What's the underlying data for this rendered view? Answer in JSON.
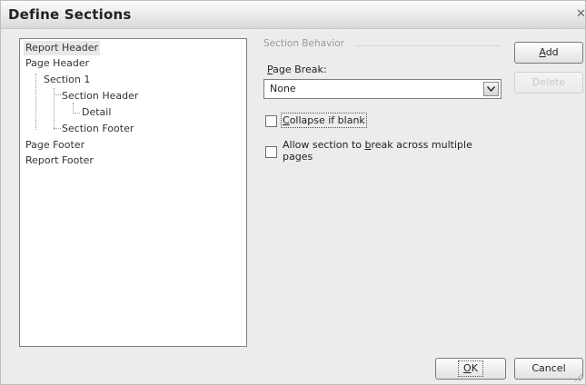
{
  "window": {
    "title": "Define Sections",
    "close_glyph": "✕"
  },
  "tree": {
    "items": [
      {
        "label": "Report Header",
        "selected": true
      },
      {
        "label": "Page Header"
      },
      {
        "label": "Section 1"
      },
      {
        "label": "Section Header"
      },
      {
        "label": "Detail"
      },
      {
        "label": "Section Footer"
      },
      {
        "label": "Page Footer"
      },
      {
        "label": "Report Footer"
      }
    ]
  },
  "section_behavior": {
    "group_label": "Section Behavior",
    "page_break": {
      "label_u": "P",
      "label_rest": "age Break:",
      "value": "None"
    },
    "collapse": {
      "label_u": "C",
      "label_rest": "ollapse if blank",
      "checked": false
    },
    "allow_break": {
      "line1_a": "Allow section to ",
      "line1_u": "b",
      "line1_b": "reak across multiple",
      "line2": "pages",
      "checked": false
    }
  },
  "buttons": {
    "add": {
      "u": "A",
      "rest": "dd"
    },
    "remove": "Delete",
    "ok": {
      "u": "O",
      "rest": "K"
    },
    "cancel": "Cancel"
  }
}
